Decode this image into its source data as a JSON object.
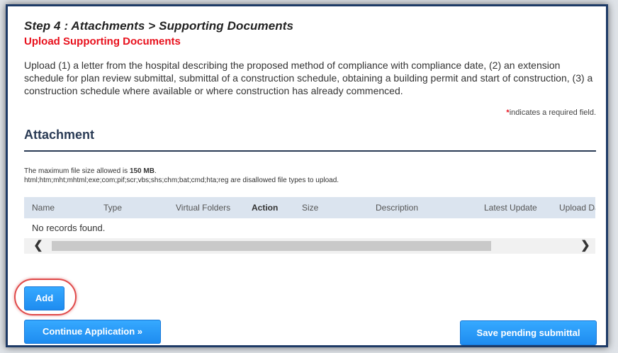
{
  "step_title": "Step 4 : Attachments > Supporting Documents",
  "sub_title": "Upload Supporting Documents",
  "instructions": "Upload (1) a letter from the hospital describing the proposed method of compliance with compliance date, (2) an extension schedule for plan review submittal, submittal of a construction schedule, obtaining a building permit and start of construction, (3) a construction schedule where available or where construction has already commenced.",
  "required_note": {
    "star": "*",
    "text": "indicates a required field."
  },
  "section_title": "Attachment",
  "info": {
    "max_size_prefix": "The maximum file size allowed is ",
    "max_size_value": "150 MB",
    "max_size_suffix": ".",
    "disallowed": "html;htm;mht;mhtml;exe;com;pif;scr;vbs;shs;chm;bat;cmd;hta;reg are disallowed file types to upload."
  },
  "grid": {
    "columns": [
      "Name",
      "Type",
      "Virtual Folders",
      "Action",
      "Size",
      "Description",
      "Latest Update",
      "Upload Da"
    ],
    "empty_text": "No records found.",
    "scroll_left_icon": "chevron-left-icon",
    "scroll_right_icon": "chevron-right-icon"
  },
  "buttons": {
    "add": "Add",
    "continue": "Continue Application »",
    "save": "Save pending submittal"
  },
  "colors": {
    "accent_red": "#e8101c",
    "button_blue": "#1e8cf0",
    "header_bg": "#dbe4ef",
    "frame_border": "#1d3a66"
  }
}
